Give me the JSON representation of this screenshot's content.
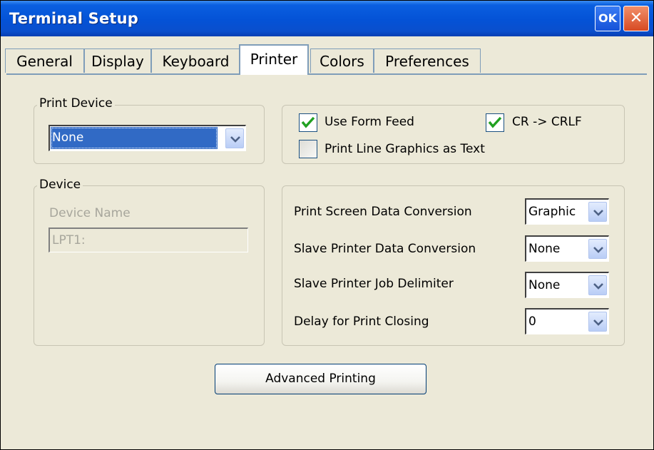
{
  "window": {
    "title": "Terminal Setup",
    "ok_label": "OK",
    "close_label": "✕"
  },
  "tabs": [
    {
      "label": "General"
    },
    {
      "label": "Display"
    },
    {
      "label": "Keyboard"
    },
    {
      "label": "Printer",
      "active": true
    },
    {
      "label": "Colors"
    },
    {
      "label": "Preferences"
    }
  ],
  "print_device": {
    "legend": "Print Device",
    "value": "None"
  },
  "options": {
    "use_form_feed": {
      "label": "Use Form Feed",
      "checked": true
    },
    "cr_crlf": {
      "label": "CR -> CRLF",
      "checked": true
    },
    "line_graphics": {
      "label": "Print Line Graphics as Text",
      "checked": false
    }
  },
  "device": {
    "legend": "Device",
    "name_label": "Device Name",
    "name_value": "LPT1:"
  },
  "conversion": {
    "print_screen": {
      "label": "Print Screen Data Conversion",
      "value": "Graphic"
    },
    "slave_data": {
      "label": "Slave Printer Data Conversion",
      "value": "None"
    },
    "slave_delim": {
      "label": "Slave Printer Job Delimiter",
      "value": "None"
    },
    "delay": {
      "label": "Delay for Print Closing",
      "value": "0"
    }
  },
  "advanced_button": "Advanced Printing",
  "colors": {
    "title_bar": "#0452d6",
    "dialog_bg": "#ece9d8",
    "selection": "#316ac5",
    "check_green": "#21a121"
  }
}
